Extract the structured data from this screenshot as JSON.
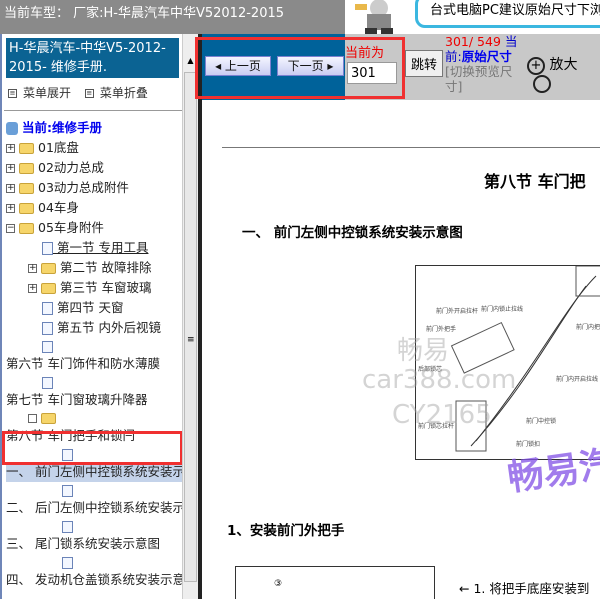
{
  "topbar": {
    "vehicle": "当前车型： 厂家:H-华晨汽车中华V52012-2015"
  },
  "banner": {
    "text": "台式电脑PC建议原始尺寸下浏"
  },
  "sidebar": {
    "title": "H-华晨汽车-中华V5-2012-2015- 维修手册.",
    "expand": "菜单展开",
    "collapse": "菜单折叠",
    "current": "当前:维修手册",
    "items": [
      {
        "label": "01底盘"
      },
      {
        "label": "02动力总成"
      },
      {
        "label": "03动力总成附件"
      },
      {
        "label": "04车身"
      },
      {
        "label": "05车身附件"
      },
      {
        "label": "第一节 专用工具"
      },
      {
        "label": "第二节 故障排除"
      },
      {
        "label": "第三节 车窗玻璃"
      },
      {
        "label": "第四节 天窗"
      },
      {
        "label": "第五节 内外后视镜"
      },
      {
        "label": "第六节 车门饰件和防水薄膜"
      },
      {
        "label": "第七节 车门窗玻璃升降器"
      },
      {
        "label": "第八节 车门把手和锁闩"
      },
      {
        "label": "一、  前门左侧中控锁系统安装示意图"
      },
      {
        "label": "二、  后门左侧中控锁系统安装示意图"
      },
      {
        "label": "三、  尾门锁系统安装示意图"
      },
      {
        "label": "四、  发动机仓盖锁系统安装示意图"
      }
    ]
  },
  "toolbar": {
    "prev": "上一页",
    "next": "下一页",
    "current_label": "当前为",
    "page_value": "301",
    "jump": "跳转",
    "page_count": "301/ 549",
    "current_prefix": "当前:",
    "size_mode": "原始尺寸",
    "switch_hint": "[切换预览尺寸]",
    "zoom_in": "放大"
  },
  "document": {
    "section_title": "第八节  车门把",
    "heading1": "一、  前门左侧中控锁系统安装示意图",
    "heading2": "1、安装前门外把手",
    "step1": "1. 将把手底座安装到",
    "figure_labels": [
      "前门外开启拉杆",
      "前门外把手",
      "后部锁芯",
      "前门内锁止拉线",
      "前门内把手",
      "前门内开启拉线",
      "前门锁芯拉杆",
      "前门中控锁",
      "前门锁扣"
    ],
    "watermarks": [
      "畅易",
      "car388.com",
      "CY2165",
      "畅易汽"
    ]
  },
  "colors": {
    "nav_blue": "#00629a",
    "highlight_red": "#f03030",
    "selected": "#c4d3ea"
  }
}
